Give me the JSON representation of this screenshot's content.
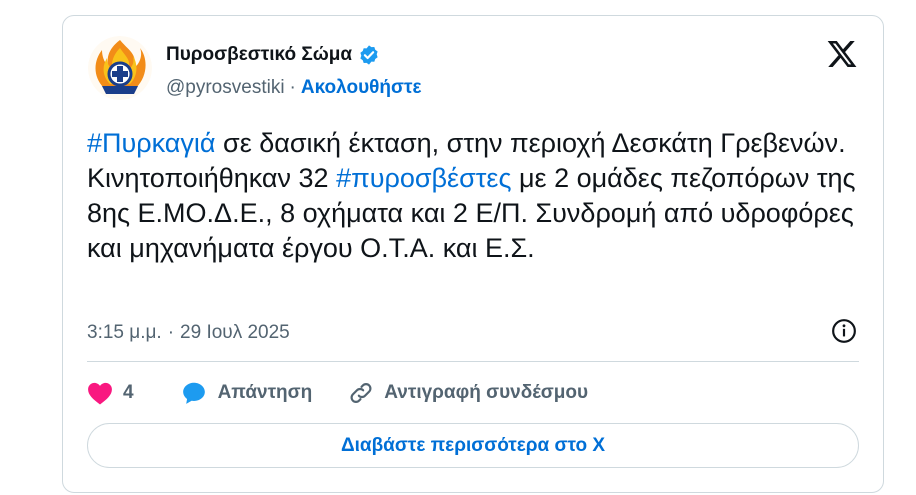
{
  "tweet": {
    "author_name": "Πυροσβεστικό Σώμα",
    "handle": "@pyrosvestiki",
    "separator": "·",
    "follow_label": "Ακολουθήστε",
    "text_parts": {
      "hashtag1": "#Πυρκαγιά",
      "part1": " σε δασική έκταση, στην περιοχή Δεσκάτη Γρεβενών. Κινητοποιήθηκαν 32 ",
      "hashtag2": "#πυροσβέστες",
      "part2": " με 2 ομάδες πεζοπόρων της 8ης Ε.ΜΟ.Δ.Ε., 8 οχήματα και 2 Ε/Π. Συνδρομή από υδροφόρες και μηχανήματα έργου Ο.Τ.Α. και Ε.Σ."
    },
    "time": "3:15 μ.μ.",
    "date": "29 Ιουλ 2025",
    "like_count": "4",
    "reply_label": "Απάντηση",
    "copy_link_label": "Αντιγραφή συνδέσμου",
    "read_more_label": "Διαβάστε περισσότερα στο X"
  },
  "icons": {
    "verified": "verified-badge-icon",
    "x_logo": "x-logo-icon",
    "info": "info-icon",
    "like": "heart-icon",
    "reply": "speech-bubble-icon",
    "link": "link-icon"
  },
  "colors": {
    "accent": "#006fd6",
    "heart": "#f91880",
    "reply": "#1d9bf0",
    "muted": "#536471",
    "border": "#cfd9de"
  }
}
